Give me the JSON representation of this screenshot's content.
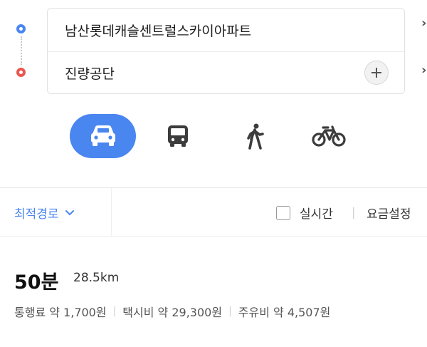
{
  "route": {
    "origin": "남산롯데캐슬센트럴스카이아파트",
    "destination": "진량공단",
    "origin_color": "#4a86f0",
    "destination_color": "#e8584f"
  },
  "modes": [
    {
      "name": "car",
      "icon": "car-icon",
      "active": true
    },
    {
      "name": "bus",
      "icon": "bus-icon",
      "active": false
    },
    {
      "name": "walk",
      "icon": "walk-icon",
      "active": false
    },
    {
      "name": "bike",
      "icon": "bike-icon",
      "active": false
    }
  ],
  "accent_color": "#4a86f0",
  "options": {
    "sort_label": "최적경로",
    "realtime_label": "실시간",
    "realtime_checked": false,
    "separator": "|",
    "fare_settings_label": "요금설정"
  },
  "result": {
    "duration": "50분",
    "distance": "28.5km",
    "toll": "통행료 약 1,700원",
    "taxi": "택시비 약 29,300원",
    "fuel": "주유비 약 4,507원",
    "separator": "|"
  }
}
